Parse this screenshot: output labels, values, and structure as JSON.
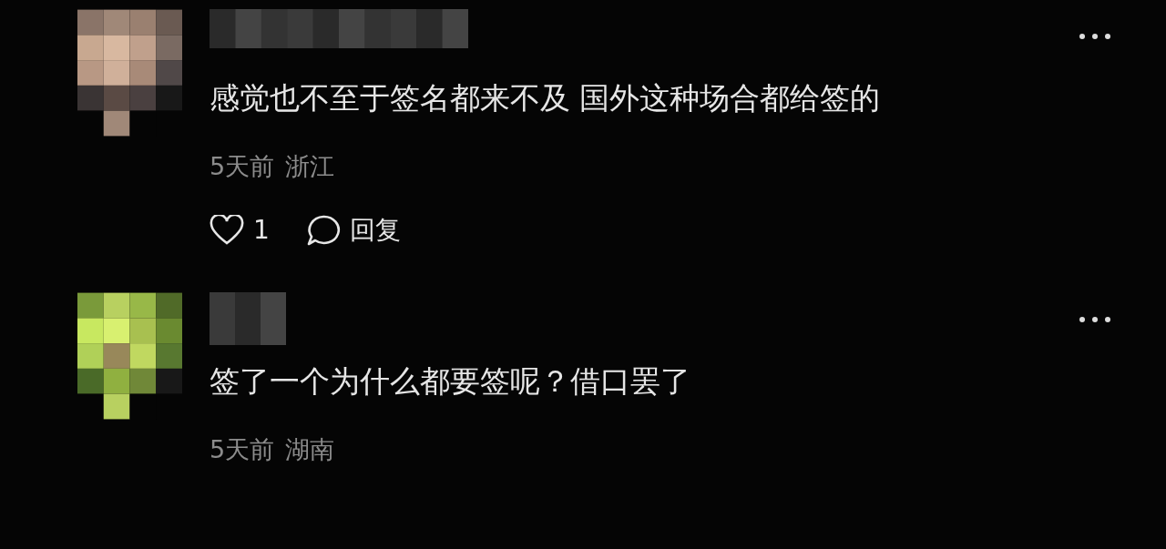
{
  "comments": [
    {
      "text": "感觉也不至于签名都来不及 国外这种场合都给签的",
      "time": "5天前",
      "location": "浙江",
      "actions": {
        "likes": "1",
        "reply": "回复"
      }
    },
    {
      "text": "签了一个为什么都要签呢？借口罢了",
      "time": "5天前",
      "location": "湖南"
    }
  ]
}
